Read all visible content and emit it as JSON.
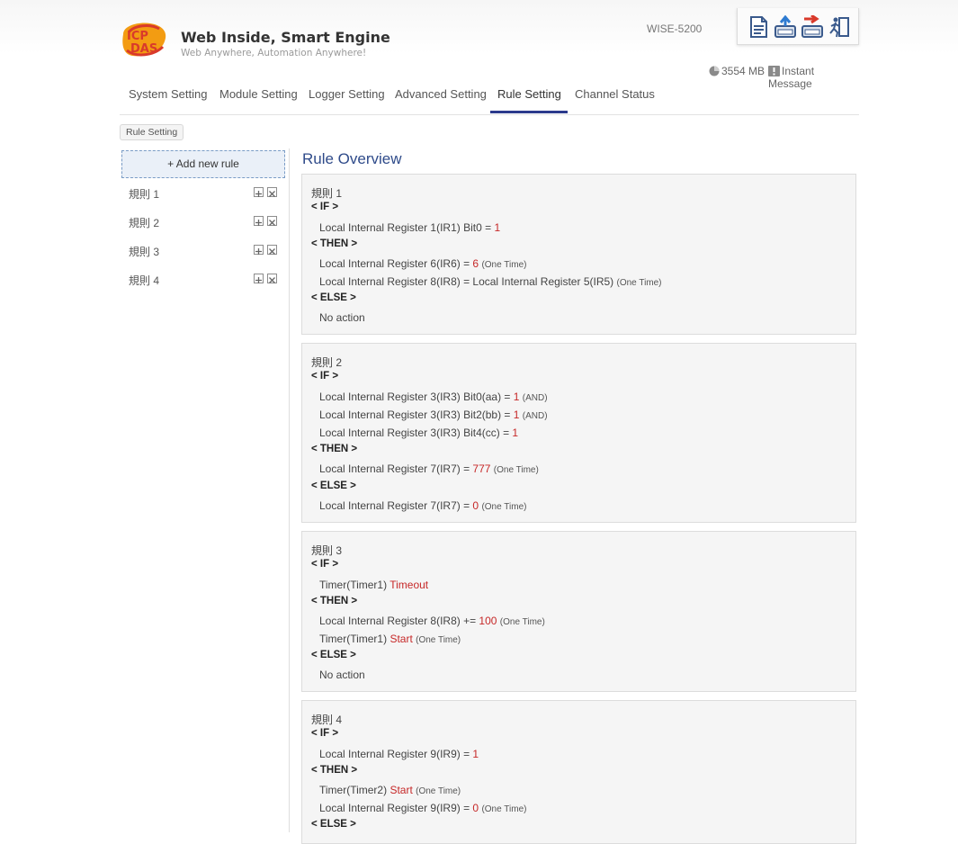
{
  "header": {
    "brand_title": "Web Inside, Smart Engine",
    "brand_subtitle": "Web Anywhere, Automation Anywhere!",
    "device_model": "WISE-5200",
    "storage": "3554 MB",
    "instant_message": "Instant Message",
    "logo_text": "ICP DAS"
  },
  "nav": {
    "tabs": [
      {
        "label": "System Setting"
      },
      {
        "label": "Module Setting"
      },
      {
        "label": "Logger Setting"
      },
      {
        "label": "Advanced Setting"
      },
      {
        "label": "Rule Setting"
      },
      {
        "label": "Channel Status"
      }
    ],
    "active": "Rule Setting"
  },
  "breadcrumb": "Rule Setting",
  "sidebar": {
    "add_label": "+ Add new rule",
    "rules": [
      {
        "label": "規則 1"
      },
      {
        "label": "規則 2"
      },
      {
        "label": "規則 3"
      },
      {
        "label": "規則 4"
      }
    ]
  },
  "overview": {
    "title": "Rule Overview",
    "section_if": "< IF >",
    "section_then": "< THEN >",
    "section_else": "< ELSE >",
    "rules": [
      {
        "name": "規則 1",
        "if_lines": [
          {
            "pre": "Local Internal Register 1(IR1) Bit0 = ",
            "val": "1",
            "post": "",
            "note": ""
          }
        ],
        "then_lines": [
          {
            "pre": "Local Internal Register 6(IR6) = ",
            "val": "6",
            "post": " ",
            "note": "(One Time)"
          },
          {
            "pre": "Local Internal Register 8(IR8) = Local Internal Register 5(IR5) ",
            "val": "",
            "post": "",
            "note": "(One Time)"
          }
        ],
        "else_lines": [
          {
            "pre": "No action",
            "val": "",
            "post": "",
            "note": ""
          }
        ]
      },
      {
        "name": "規則 2",
        "if_lines": [
          {
            "pre": "Local Internal Register 3(IR3) Bit0(aa) = ",
            "val": "1",
            "post": " ",
            "note": "(AND)"
          },
          {
            "pre": "Local Internal Register 3(IR3) Bit2(bb) = ",
            "val": "1",
            "post": " ",
            "note": "(AND)"
          },
          {
            "pre": "Local Internal Register 3(IR3) Bit4(cc) = ",
            "val": "1",
            "post": "",
            "note": ""
          }
        ],
        "then_lines": [
          {
            "pre": "Local Internal Register 7(IR7) = ",
            "val": "777",
            "post": " ",
            "note": "(One Time)"
          }
        ],
        "else_lines": [
          {
            "pre": "Local Internal Register 7(IR7) = ",
            "val": "0",
            "post": " ",
            "note": "(One Time)"
          }
        ]
      },
      {
        "name": "規則 3",
        "if_lines": [
          {
            "pre": "Timer(Timer1) ",
            "val": "Timeout",
            "post": "",
            "note": ""
          }
        ],
        "then_lines": [
          {
            "pre": "Local Internal Register 8(IR8) += ",
            "val": "100",
            "post": " ",
            "note": "(One Time)"
          },
          {
            "pre": "Timer(Timer1) ",
            "val": "Start",
            "post": " ",
            "note": "(One Time)"
          }
        ],
        "else_lines": [
          {
            "pre": "No action",
            "val": "",
            "post": "",
            "note": ""
          }
        ]
      },
      {
        "name": "規則 4",
        "if_lines": [
          {
            "pre": "Local Internal Register 9(IR9) = ",
            "val": "1",
            "post": "",
            "note": ""
          }
        ],
        "then_lines": [
          {
            "pre": "Timer(Timer2) ",
            "val": "Start",
            "post": " ",
            "note": "(One Time)"
          },
          {
            "pre": "Local Internal Register 9(IR9) = ",
            "val": "0",
            "post": " ",
            "note": "(One Time)"
          }
        ],
        "else_lines": []
      }
    ]
  },
  "colors": {
    "accent_blue": "#2b3a8c",
    "title_blue": "#2f4b8a",
    "value_red": "#c62828",
    "logo_orange": "#f39c12",
    "logo_red": "#d93a2b"
  }
}
